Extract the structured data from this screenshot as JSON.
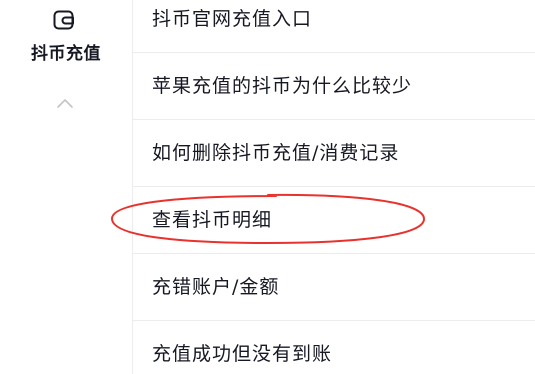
{
  "sidebar": {
    "category": {
      "icon": "wallet-icon",
      "label": "抖币充值"
    },
    "collapse_icon": "chevron-up-icon"
  },
  "list": {
    "items": [
      {
        "label": "抖币官网充值入口"
      },
      {
        "label": "苹果充值的抖币为什么比较少"
      },
      {
        "label": "如何删除抖币充值/消费记录"
      },
      {
        "label": "查看抖币明细",
        "highlighted": true
      },
      {
        "label": "充错账户/金额"
      },
      {
        "label": "充值成功但没有到账"
      }
    ]
  },
  "annotation": {
    "shape": "ellipse",
    "color": "#e8322d",
    "target": "查看抖币明细"
  }
}
